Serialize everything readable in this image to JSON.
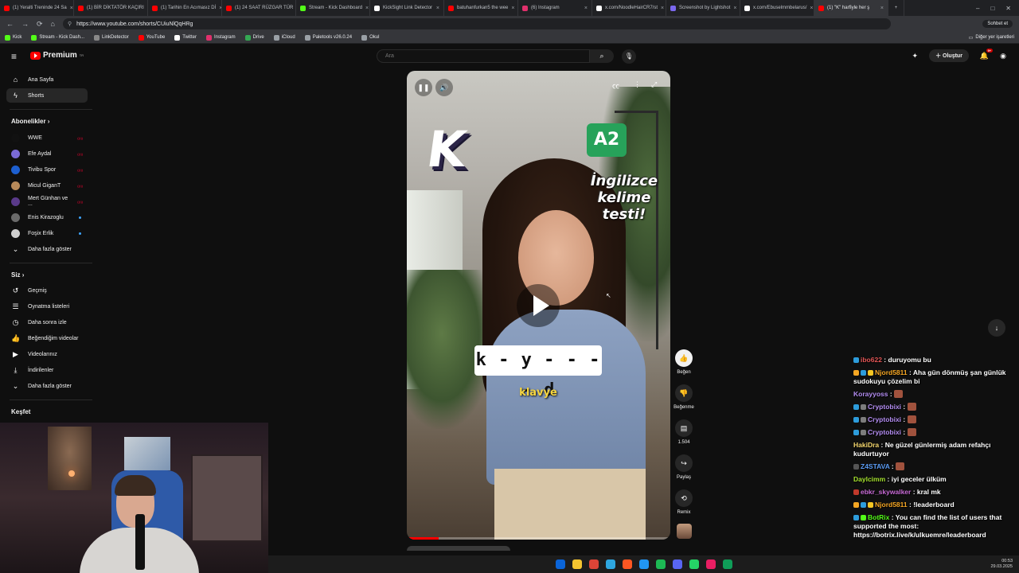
{
  "browser": {
    "tabs": [
      {
        "title": "(1) Yeralti Treninde 24 Sa",
        "color": "#ff0000"
      },
      {
        "title": "(1) BİR DİKTATÖR KAÇIRI",
        "color": "#ff0000"
      },
      {
        "title": "(1) Tarihin En Acımasız Dİ",
        "color": "#ff0000"
      },
      {
        "title": "(1) 24 SAAT RÜZGAR TÜR",
        "color": "#ff0000"
      },
      {
        "title": "Stream - Kick Dashboard",
        "color": "#53fc18"
      },
      {
        "title": "KickSight Link Detector",
        "color": "#ffffff"
      },
      {
        "title": "batuhanfurkan5 the wee",
        "color": "#ff0000"
      },
      {
        "title": "(6) Instagram",
        "color": "#e1306c"
      },
      {
        "title": "x.com/NoodleHairCR7/st",
        "color": "#ffffff"
      },
      {
        "title": "Screenshot by Lightshot",
        "color": "#7b68ee"
      },
      {
        "title": "x.com/Ebuselmmbelarus/",
        "color": "#ffffff"
      },
      {
        "title": "(1) \"K\" harfiyle her ş",
        "color": "#ff0000"
      }
    ],
    "url": "https://www.youtube.com/shorts/CUiuNlQqHRg",
    "chat_button": "Sohbet et",
    "bookmarks": [
      {
        "label": "Kick",
        "color": "#53fc18"
      },
      {
        "label": "Stream - Kick Dash...",
        "color": "#53fc18"
      },
      {
        "label": "LinkDetector",
        "color": "#888888"
      },
      {
        "label": "YouTube",
        "color": "#ff0000"
      },
      {
        "label": "Twitter",
        "color": "#ffffff"
      },
      {
        "label": "Instagram",
        "color": "#e1306c"
      },
      {
        "label": "Drive",
        "color": "#34a853"
      },
      {
        "label": "iCloud",
        "color": "#9aa0a6"
      },
      {
        "label": "Paletools v26.0.24",
        "color": "#9aa0a6"
      },
      {
        "label": "Okul",
        "color": "#9aa0a6"
      }
    ],
    "other_bookmarks": "Diğer yer işaretleri"
  },
  "header": {
    "logo": "Premium",
    "logo_region": "TR",
    "search_placeholder": "Ara",
    "create_label": "Oluştur",
    "notif_count": "9+"
  },
  "sidebar": {
    "main": [
      {
        "label": "Ana Sayfa",
        "icon": "home-icon",
        "glyph": "⌂"
      },
      {
        "label": "Shorts",
        "icon": "shorts-icon",
        "glyph": "ϟ"
      }
    ],
    "subs_title": "Abonelikler",
    "subs": [
      {
        "label": "WWE",
        "color": "#111111",
        "status": "live"
      },
      {
        "label": "Efe Aydal",
        "color": "#7a6ad6",
        "status": "live"
      },
      {
        "label": "Tivibu Spor",
        "color": "#1d5fd0",
        "status": "live"
      },
      {
        "label": "Micul GiganT",
        "color": "#b88a5a",
        "status": "live"
      },
      {
        "label": "Mert Günhan ve ...",
        "color": "#5a3a8a",
        "status": "live"
      },
      {
        "label": "Enis Kirazoglu",
        "color": "#6a6a6a",
        "status": "new"
      },
      {
        "label": "Foşix Erlik",
        "color": "#cfcfcf",
        "status": "new"
      }
    ],
    "live_badge": "((•))",
    "show_more": "Daha fazla göster",
    "you_title": "Siz",
    "you": [
      {
        "label": "Geçmiş",
        "icon": "history-icon",
        "glyph": "↺"
      },
      {
        "label": "Oynatma listeleri",
        "icon": "playlist-icon",
        "glyph": "☰"
      },
      {
        "label": "Daha sonra izle",
        "icon": "watch-later-icon",
        "glyph": "◷"
      },
      {
        "label": "Beğendiğim videolar",
        "icon": "liked-icon",
        "glyph": "👍"
      },
      {
        "label": "Videolarınız",
        "icon": "your-videos-icon",
        "glyph": "▶"
      },
      {
        "label": "İndirilenler",
        "icon": "download-icon",
        "glyph": "⤓"
      }
    ],
    "show_more2": "Daha fazla göster",
    "explore_title": "Keşfet"
  },
  "video": {
    "badge": "A2",
    "topic": "İngilizce kelime testi!",
    "letter": "K",
    "word_hint": "k - y - - - - d",
    "answer": "klavye",
    "progress": 0.12
  },
  "actions": {
    "like": "Beğen",
    "dislike": "Beğenme",
    "comments": "1.504",
    "share": "Paylaş",
    "remix": "Remix"
  },
  "chat": [
    {
      "user": "ibo622",
      "ucolor": "#e25555",
      "text": "duruyomu bu",
      "badges": [
        "#2d9cdb"
      ]
    },
    {
      "user": "Njord5811",
      "ucolor": "#f5a623",
      "text": "Aha gün dönmüş şan günlük sudokuyu çözelim bi",
      "badges": [
        "#f5a623",
        "#2d9cdb",
        "#f5c623"
      ]
    },
    {
      "user": "Korayyoss",
      "ucolor": "#b28cf0",
      "text": "",
      "emote": true,
      "badges": []
    },
    {
      "user": "Cryptobixi",
      "ucolor": "#b28cf0",
      "text": "",
      "emote": true,
      "badges": [
        "#2d9cdb",
        "#7d7d7d"
      ]
    },
    {
      "user": "Cryptobixi",
      "ucolor": "#b28cf0",
      "text": "",
      "emote": true,
      "badges": [
        "#2d9cdb",
        "#7d7d7d"
      ]
    },
    {
      "user": "Cryptobixi",
      "ucolor": "#b28cf0",
      "text": "",
      "emote": true,
      "badges": [
        "#2d9cdb",
        "#7d7d7d"
      ]
    },
    {
      "user": "HakiDra",
      "ucolor": "#f5d76e",
      "text": "Ne güzel günlermiş adam refahçı kudurtuyor",
      "badges": []
    },
    {
      "user": "Z4STAVA",
      "ucolor": "#5b9cf5",
      "text": "",
      "emote": true,
      "badges": [
        "#555555"
      ]
    },
    {
      "user": "Daylcimm",
      "ucolor": "#a6e22e",
      "text": "iyi geceler ülküm",
      "badges": []
    },
    {
      "user": "ebkr_skywalker",
      "ucolor": "#c86bd6",
      "text": "kral mk",
      "badges": [
        "#c0392b"
      ]
    },
    {
      "user": "Njord5811",
      "ucolor": "#f5a623",
      "text": "!leaderboard",
      "badges": [
        "#f5a623",
        "#2d9cdb",
        "#f5c623"
      ]
    },
    {
      "user": "BotRix",
      "ucolor": "#53fc18",
      "text": "You can find the list of users that supported the most: https://botrix.live/k/ulkuemre/leaderboard",
      "badges": [
        "#2d9cdb",
        "#53fc18"
      ]
    }
  ],
  "taskbar": {
    "icons": [
      "#0a64d8",
      "#f4c430",
      "#db4437",
      "#2ea6e0",
      "#ff5722",
      "#2196f3",
      "#1db954",
      "#5865f2",
      "#25d366",
      "#e91e63",
      "#0f9d58"
    ],
    "time": "00:53",
    "date": "29.03.2025"
  }
}
